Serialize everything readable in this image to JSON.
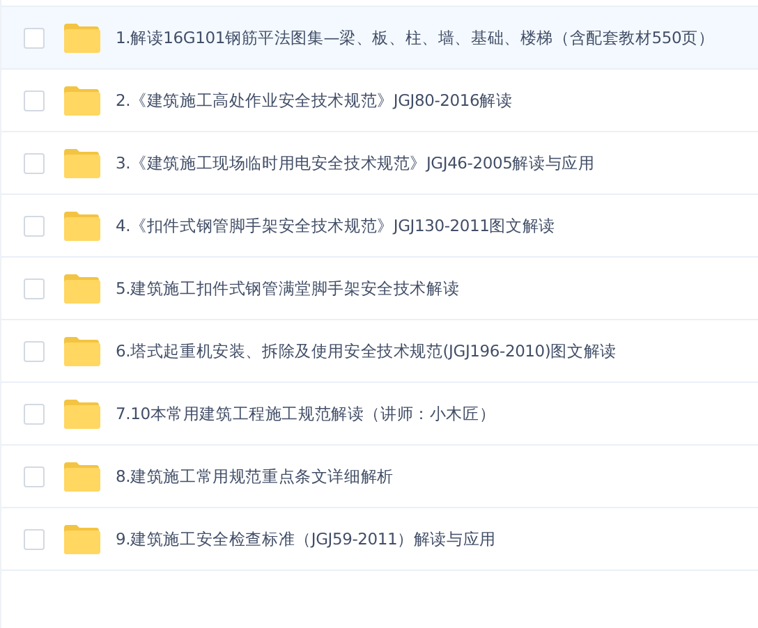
{
  "files": [
    {
      "name": "1.解读16G101钢筋平法图集—梁、板、柱、墙、基础、楼梯（含配套教材550页）",
      "selected": true,
      "checked": false
    },
    {
      "name": "2.《建筑施工高处作业安全技术规范》JGJ80-2016解读",
      "selected": false,
      "checked": false
    },
    {
      "name": "3.《建筑施工现场临时用电安全技术规范》JGJ46-2005解读与应用",
      "selected": false,
      "checked": false
    },
    {
      "name": "4.《扣件式钢管脚手架安全技术规范》JGJ130-2011图文解读",
      "selected": false,
      "checked": false
    },
    {
      "name": "5.建筑施工扣件式钢管满堂脚手架安全技术解读",
      "selected": false,
      "checked": false
    },
    {
      "name": "6.塔式起重机安装、拆除及使用安全技术规范(JGJ196-2010)图文解读",
      "selected": false,
      "checked": false
    },
    {
      "name": "7.10本常用建筑工程施工规范解读（讲师：小木匠）",
      "selected": false,
      "checked": false
    },
    {
      "name": "8.建筑施工常用规范重点条文详细解析",
      "selected": false,
      "checked": false
    },
    {
      "name": "9.建筑施工安全检查标准（JGJ59-2011）解读与应用",
      "selected": false,
      "checked": false
    }
  ]
}
